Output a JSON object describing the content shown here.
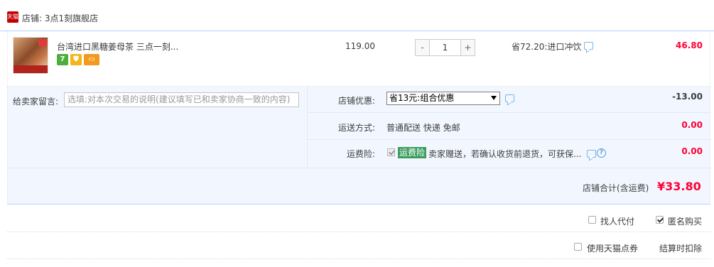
{
  "shop": {
    "badge_text": "天猫",
    "label": "店铺: 3点1刻旗舰店"
  },
  "item": {
    "title": "台湾进口黑糖姜母茶 三点一刻...",
    "service_icons": [
      "seven-day-return-icon",
      "guarantee-shield-icon",
      "credit-card-icon"
    ],
    "unit_price": "119.00",
    "quantity": {
      "decrement": "-",
      "value": "1",
      "increment": "+"
    },
    "promo": "省72.20:进口冲饮",
    "subtotal": "46.80"
  },
  "memo": {
    "label": "给卖家留言:",
    "placeholder": "选填:对本次交易的说明(建议填写已和卖家协商一致的内容)"
  },
  "discount": {
    "label": "店铺优惠:",
    "selected": "省13元:组合优惠",
    "amount": "-13.00"
  },
  "shipping": {
    "label": "运送方式:",
    "value": "普通配送 快递 免邮",
    "amount": "0.00"
  },
  "insurance": {
    "label": "运费险:",
    "tag": "运费险",
    "text": "卖家赠送，若确认收货前退货，可获保...",
    "help": "?",
    "amount": "0.00"
  },
  "total": {
    "label": "店铺合计(含运费)",
    "amount": "¥33.80"
  },
  "options": {
    "proxy_pay_label": "找人代付",
    "anonymous_label": "匿名购买",
    "points_label": "使用天猫点券",
    "points_note": "结算时扣除"
  },
  "colors": {
    "price_red": "#ff0036",
    "panel_bg": "#f2f7ff",
    "border_blue": "#b2d1ff",
    "insurance_green": "#3a9d5d",
    "tmall_red": "#c40000"
  }
}
